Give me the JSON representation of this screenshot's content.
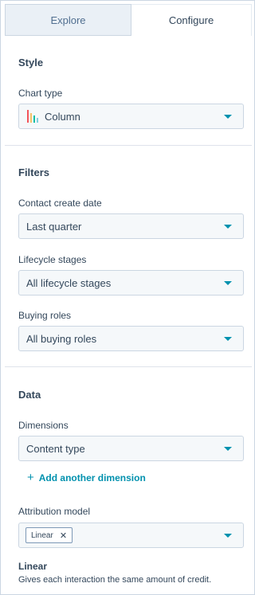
{
  "tabs": {
    "explore": "Explore",
    "configure": "Configure"
  },
  "style_section": {
    "title": "Style",
    "chart_type_label": "Chart type",
    "chart_type_value": "Column",
    "chart_type_icon": "column-chart-icon"
  },
  "filters_section": {
    "title": "Filters",
    "contact_create_date_label": "Contact create date",
    "contact_create_date_value": "Last quarter",
    "lifecycle_stages_label": "Lifecycle stages",
    "lifecycle_stages_value": "All lifecycle stages",
    "buying_roles_label": "Buying roles",
    "buying_roles_value": "All buying roles"
  },
  "data_section": {
    "title": "Data",
    "dimensions_label": "Dimensions",
    "dimensions_value": "Content type",
    "add_dimension": "Add another dimension",
    "attribution_model_label": "Attribution model",
    "attribution_model_tag": "Linear",
    "model_description_title": "Linear",
    "model_description_text": "Gives each interaction the same amount of credit."
  },
  "colors": {
    "accent": "#0091ae",
    "text": "#33475b",
    "field_bg": "#f5f8fa",
    "border": "#cbd6e2"
  }
}
